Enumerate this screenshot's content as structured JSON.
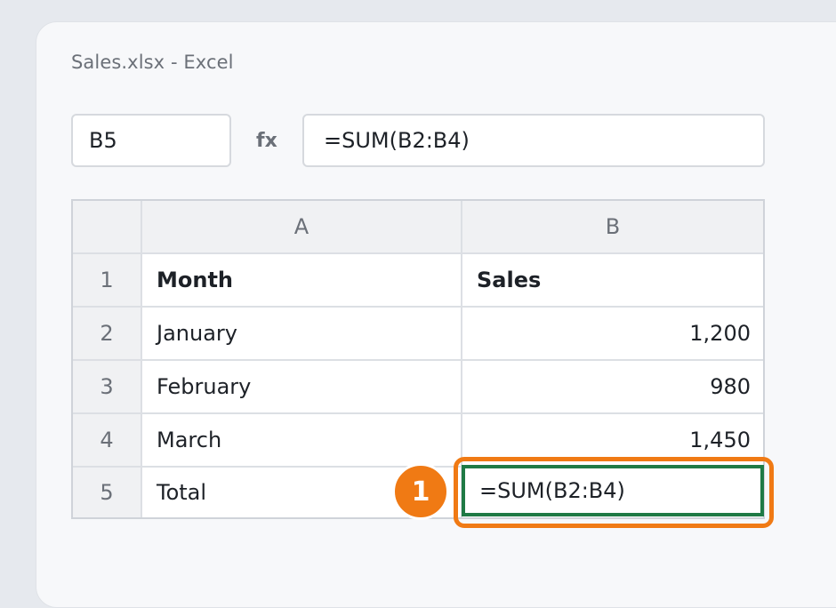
{
  "app": {
    "title": "Sales.xlsx - Excel"
  },
  "formula_bar": {
    "name_box": "B5",
    "fx_label": "fx",
    "formula": "=SUM(B2:B4)"
  },
  "grid": {
    "columns": [
      "A",
      "B"
    ],
    "rows": [
      {
        "num": "1",
        "a": "Month",
        "b": "Sales"
      },
      {
        "num": "2",
        "a": "January",
        "b": "1,200"
      },
      {
        "num": "3",
        "a": "February",
        "b": "980"
      },
      {
        "num": "4",
        "a": "March",
        "b": "1,450"
      },
      {
        "num": "5",
        "a": "Total",
        "b": "=SUM(B2:B4)"
      }
    ]
  },
  "annotation": {
    "step": "1",
    "color": "#f07a14"
  },
  "colors": {
    "selection_border": "#1f7a45",
    "callout": "#f07a14"
  }
}
